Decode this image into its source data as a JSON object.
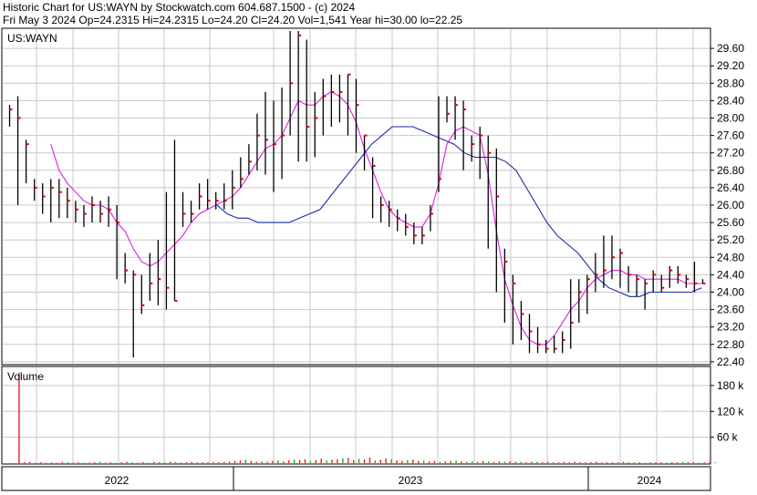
{
  "header": {
    "line1": "Historic Chart for US:WAYN by Stockwatch.com 604.687.1500 - (c) 2024",
    "line2": "Fri May  3 2024  Op=24.2315  Hi=24.2315  Lo=24.20  Cl=24.20  Vol=1,541  Year hi=30.00  lo=22.25"
  },
  "chart_data": [
    {
      "type": "line",
      "panel": "price",
      "symbol_label": "US:WAYN",
      "y_ticks": [
        "29.60",
        "29.20",
        "28.80",
        "28.40",
        "28.00",
        "27.60",
        "27.20",
        "26.80",
        "26.40",
        "26.00",
        "25.60",
        "25.20",
        "24.80",
        "24.40",
        "24.00",
        "23.60",
        "23.20",
        "22.80",
        "22.40"
      ],
      "ylim": [
        22.0,
        30.0
      ],
      "x_years": [
        "2022",
        "2023",
        "2024"
      ],
      "colors": {
        "price": "#000000",
        "close_tick": "#e0000f",
        "ma_short": "#dd22dd",
        "ma_long": "#1a2aa8",
        "grid": "#c8c8c8"
      },
      "series": [
        {
          "role": "close",
          "values": [
            28.2,
            28.0,
            27.4,
            26.4,
            26.2,
            26.4,
            26.3,
            26.1,
            25.9,
            25.8,
            26.0,
            25.8,
            25.9,
            25.6,
            24.5,
            24.4,
            23.7,
            24.2,
            24.3,
            24.1,
            23.8,
            25.8,
            25.8,
            26.2,
            26.1,
            26.1,
            26.1,
            26.4,
            26.6,
            27.0,
            27.6,
            27.5,
            27.4,
            27.6,
            28.8,
            29.9,
            27.8,
            28.0,
            28.5,
            28.6,
            28.6,
            29.0,
            28.3,
            27.6,
            26.9,
            26.0,
            25.9,
            25.7,
            25.5,
            25.3,
            25.3,
            25.8,
            26.6,
            28.1,
            28.3,
            28.2,
            27.4,
            27.6,
            27.2,
            26.2,
            24.7,
            24.2,
            23.5,
            23.1,
            22.8,
            22.7,
            22.7,
            22.9,
            23.3,
            24.0,
            24.3,
            24.4,
            24.5,
            24.8,
            24.9,
            24.4,
            24.3,
            24.2,
            24.4,
            24.1,
            24.5,
            24.4,
            24.3,
            24.2,
            24.2
          ]
        },
        {
          "role": "high",
          "values": [
            28.3,
            28.5,
            27.5,
            26.6,
            26.5,
            26.6,
            26.6,
            26.4,
            26.1,
            26.0,
            26.2,
            26.1,
            26.2,
            26.0,
            24.9,
            24.5,
            24.4,
            24.9,
            25.2,
            26.3,
            27.5,
            26.3,
            26.1,
            26.5,
            26.6,
            26.3,
            26.5,
            26.8,
            27.1,
            27.4,
            28.1,
            28.6,
            28.4,
            28.7,
            30.0,
            30.0,
            29.8,
            28.6,
            28.9,
            29.0,
            29.0,
            29.0,
            28.9,
            27.6,
            27.1,
            26.2,
            26.1,
            25.9,
            25.8,
            25.6,
            25.5,
            26.0,
            28.5,
            28.5,
            28.5,
            28.4,
            27.6,
            27.8,
            27.6,
            27.3,
            25.0,
            24.4,
            23.8,
            23.5,
            23.2,
            22.9,
            23.0,
            23.1,
            24.3,
            24.3,
            24.4,
            24.9,
            25.3,
            25.3,
            25.0,
            24.6,
            24.4,
            24.3,
            24.5,
            24.4,
            24.6,
            24.6,
            24.4,
            24.7,
            24.3
          ]
        },
        {
          "role": "low",
          "values": [
            27.8,
            26.0,
            26.5,
            26.1,
            25.8,
            25.6,
            25.7,
            25.7,
            25.6,
            25.5,
            25.6,
            25.6,
            25.5,
            24.3,
            24.2,
            22.5,
            23.5,
            23.8,
            23.7,
            23.6,
            23.8,
            25.5,
            25.6,
            25.9,
            25.9,
            25.9,
            25.9,
            25.9,
            26.4,
            26.7,
            26.8,
            26.7,
            26.3,
            26.6,
            27.6,
            27.0,
            27.0,
            27.1,
            27.6,
            27.8,
            27.9,
            27.6,
            27.2,
            26.8,
            25.7,
            25.6,
            25.5,
            25.4,
            25.3,
            25.1,
            25.1,
            25.4,
            26.3,
            27.9,
            27.5,
            26.8,
            27.0,
            26.6,
            25.0,
            24.0,
            23.3,
            22.8,
            22.9,
            22.6,
            22.6,
            22.6,
            22.6,
            22.6,
            22.7,
            23.3,
            23.5,
            24.0,
            24.1,
            24.3,
            24.1,
            24.0,
            23.9,
            23.6,
            24.0,
            24.0,
            24.1,
            24.2,
            24.1,
            24.0,
            24.2
          ]
        },
        {
          "role": "ma_short",
          "values": [
            null,
            null,
            null,
            null,
            null,
            27.4,
            26.8,
            26.5,
            26.3,
            26.1,
            26.0,
            26.0,
            25.9,
            25.6,
            25.4,
            25.0,
            24.7,
            24.6,
            24.7,
            24.9,
            25.1,
            25.3,
            25.6,
            25.8,
            25.9,
            26.0,
            26.1,
            26.2,
            26.4,
            26.7,
            27.0,
            27.3,
            27.4,
            27.6,
            28.0,
            28.4,
            28.3,
            28.3,
            28.5,
            28.6,
            28.5,
            28.3,
            27.9,
            27.3,
            26.8,
            26.3,
            25.9,
            25.7,
            25.6,
            25.5,
            25.5,
            25.8,
            26.5,
            27.4,
            27.7,
            27.8,
            27.7,
            27.6,
            26.7,
            25.4,
            24.3,
            23.7,
            23.2,
            22.9,
            22.8,
            22.8,
            23.0,
            23.3,
            23.6,
            23.8,
            24.1,
            24.3,
            24.4,
            24.5,
            24.5,
            24.4,
            24.4,
            24.3,
            24.3,
            24.3,
            24.3,
            24.3,
            24.2,
            24.2,
            24.2
          ]
        },
        {
          "role": "ma_long",
          "values": [
            null,
            null,
            null,
            null,
            null,
            null,
            null,
            null,
            null,
            null,
            null,
            null,
            null,
            null,
            null,
            null,
            null,
            null,
            null,
            null,
            26.0,
            25.8,
            25.7,
            25.7,
            25.6,
            25.6,
            25.6,
            25.6,
            25.7,
            25.8,
            25.9,
            26.2,
            26.5,
            26.8,
            27.1,
            27.4,
            27.6,
            27.8,
            27.8,
            27.8,
            27.7,
            27.6,
            27.5,
            27.4,
            27.2,
            27.1,
            27.1,
            27.1,
            27.0,
            26.8,
            26.4,
            26.0,
            25.6,
            25.3,
            25.1,
            24.9,
            24.6,
            24.3,
            24.1,
            24.0,
            23.9,
            23.9,
            24.0,
            24.0,
            24.0,
            24.0,
            24.0,
            24.1
          ]
        }
      ]
    },
    {
      "type": "bar",
      "panel": "volume",
      "title": "Volume",
      "y_ticks": [
        "180 k",
        "120 k",
        "60 k"
      ],
      "ylim": [
        0,
        220
      ],
      "values": [
        210,
        2,
        3,
        1,
        2,
        1,
        2,
        1,
        3,
        2,
        1,
        2,
        1,
        1,
        2,
        3,
        1,
        2,
        1,
        2,
        3,
        2,
        1,
        2,
        1,
        3,
        2,
        2,
        3,
        2,
        2,
        2,
        3,
        2,
        2,
        2,
        3,
        2,
        3,
        4,
        5,
        6,
        8,
        5,
        3,
        4,
        3,
        5,
        6,
        4,
        6,
        8,
        7,
        9,
        5,
        7,
        10,
        6,
        8,
        9,
        11,
        12,
        7,
        10,
        9,
        13,
        6,
        8,
        11,
        9,
        6,
        5,
        7,
        8,
        5,
        6,
        4,
        5,
        3,
        4,
        5,
        6,
        4,
        3,
        4,
        3,
        5,
        4,
        3,
        4,
        3,
        4,
        3,
        3,
        2,
        3,
        3,
        2,
        3,
        2,
        2,
        3,
        2,
        3,
        2,
        2,
        2,
        3,
        2,
        2,
        2,
        2,
        3,
        2,
        2,
        2,
        1,
        2,
        2,
        2,
        1,
        2,
        2,
        3,
        2,
        2,
        1,
        2,
        2,
        2
      ]
    }
  ]
}
